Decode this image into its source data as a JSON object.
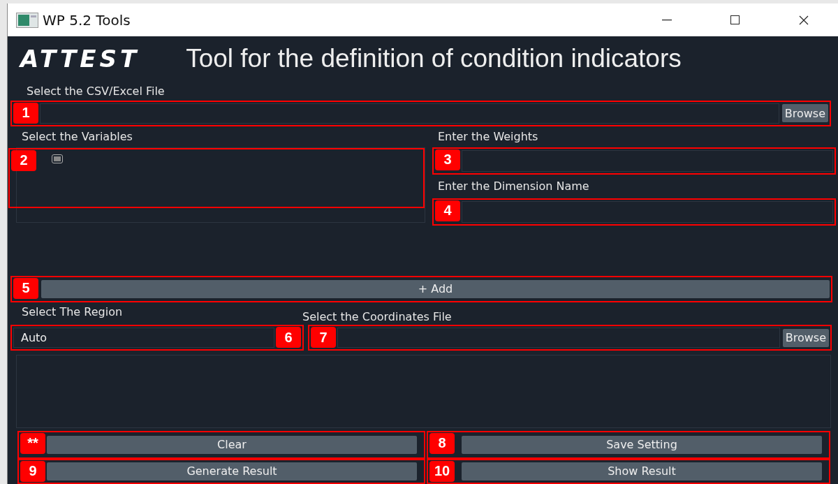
{
  "window": {
    "title": "WP 5.2 Tools"
  },
  "header": {
    "logo": "ATTEST",
    "title": "Tool for the definition of condition indicators"
  },
  "file_section": {
    "label": "Select the CSV/Excel File",
    "browse_button": "Browse",
    "annotation": "1"
  },
  "variables": {
    "label": "Select the Variables",
    "annotation": "2",
    "items": [
      {
        "checked": true
      }
    ]
  },
  "weights": {
    "label": "Enter the Weights",
    "annotation": "3"
  },
  "dimension": {
    "label": "Enter the Dimension Name",
    "annotation": "4"
  },
  "add": {
    "button": "+ Add",
    "annotation": "5"
  },
  "region": {
    "label": "Select The Region",
    "value": "Auto",
    "annotation": "6"
  },
  "coordinates": {
    "label": "Select the Coordinates File",
    "browse_button": "Browse",
    "annotation": "7"
  },
  "actions": [
    {
      "label": "Clear",
      "annotation": "**"
    },
    {
      "label": "Save Setting",
      "annotation": "8"
    },
    {
      "label": "Generate Result",
      "annotation": "9"
    },
    {
      "label": "Show Result",
      "annotation": "10"
    }
  ]
}
